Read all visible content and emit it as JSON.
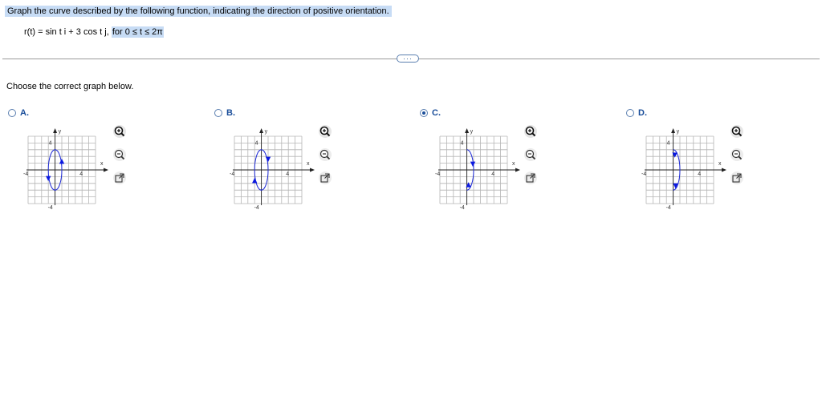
{
  "question": {
    "text": "Graph the curve described by the following function, indicating the direction of positive orientation.",
    "formula_prefix": "r(t) = sin t i + 3 cos t j, ",
    "formula_highlight": "for 0 ≤ t ≤ 2π"
  },
  "more_button": "···",
  "prompt": "Choose the correct graph below.",
  "axis_labels": {
    "x": "x",
    "y": "y",
    "pos": "4",
    "neg": "-4"
  },
  "choices": [
    {
      "label": "A.",
      "selected": false,
      "arrows": "ccw"
    },
    {
      "label": "B.",
      "selected": false,
      "arrows": "cw"
    },
    {
      "label": "C.",
      "selected": true,
      "arrows": "right-half"
    },
    {
      "label": "D.",
      "selected": false,
      "arrows": "right-half-down"
    }
  ],
  "tool_icons": [
    "zoom-in-icon",
    "zoom-out-icon",
    "pop-out-icon"
  ],
  "colors": {
    "highlight": "#c7dcf5",
    "curve": "#1f2bd6",
    "arrow": "#0b19e0",
    "grid": "#b5b5b5"
  }
}
